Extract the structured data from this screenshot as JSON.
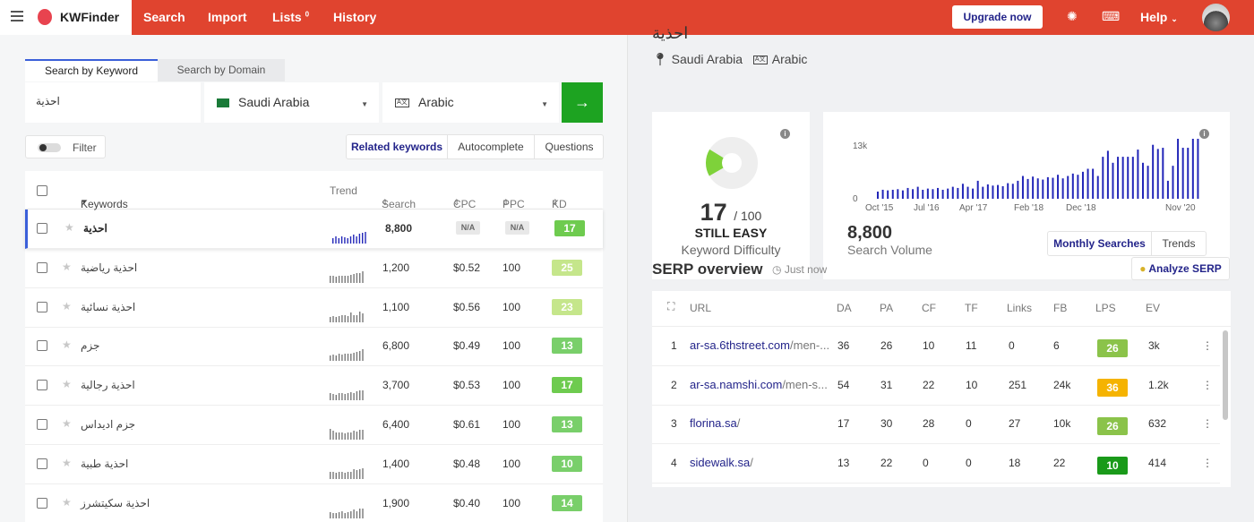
{
  "app": {
    "name": "KWFinder"
  },
  "nav": {
    "search": "Search",
    "import": "Import",
    "lists": "Lists",
    "lists_count": "0",
    "history": "History"
  },
  "topbar": {
    "upgrade": "Upgrade now",
    "help": "Help"
  },
  "search_panel": {
    "tab_keyword": "Search by Keyword",
    "tab_domain": "Search by Domain",
    "keyword": "احذية",
    "country": "Saudi Arabia",
    "language": "Arabic",
    "lang_icon_text": "A文"
  },
  "filter": {
    "label": "Filter"
  },
  "results_tabs": {
    "related": "Related keywords",
    "autocomplete": "Autocomplete",
    "questions": "Questions"
  },
  "kw_table": {
    "columns": {
      "keywords": "Keywords",
      "trend": "Trend",
      "search": "Search",
      "cpc": "CPC",
      "ppc": "PPC",
      "kd": "KD"
    },
    "rows": [
      {
        "keyword": "احذية",
        "search": "8,800",
        "cpc": "N/A",
        "ppc": "N/A",
        "kd": "17",
        "trend": [
          0.45,
          0.55,
          0.4,
          0.6,
          0.5,
          0.45,
          0.55,
          0.7,
          0.6,
          0.75,
          0.85,
          0.95
        ]
      },
      {
        "keyword": "احذية رياضية",
        "search": "1,200",
        "cpc": "$0.52",
        "ppc": "100",
        "kd": "25",
        "trend": [
          0.55,
          0.6,
          0.5,
          0.6,
          0.55,
          0.6,
          0.55,
          0.65,
          0.7,
          0.75,
          0.8,
          0.9
        ]
      },
      {
        "keyword": "احذية نسائية",
        "search": "1,100",
        "cpc": "$0.56",
        "ppc": "100",
        "kd": "23",
        "trend": [
          0.4,
          0.5,
          0.45,
          0.5,
          0.55,
          0.6,
          0.5,
          0.8,
          0.55,
          0.6,
          0.85,
          0.7
        ]
      },
      {
        "keyword": "جزم",
        "search": "6,800",
        "cpc": "$0.49",
        "ppc": "100",
        "kd": "13",
        "trend": [
          0.45,
          0.5,
          0.45,
          0.55,
          0.5,
          0.55,
          0.6,
          0.6,
          0.65,
          0.7,
          0.8,
          0.9
        ]
      },
      {
        "keyword": "احذية رجالية",
        "search": "3,700",
        "cpc": "$0.53",
        "ppc": "100",
        "kd": "17",
        "trend": [
          0.55,
          0.5,
          0.45,
          0.55,
          0.6,
          0.5,
          0.55,
          0.65,
          0.6,
          0.7,
          0.8,
          0.75
        ]
      },
      {
        "keyword": "جزم اديداس",
        "search": "6,400",
        "cpc": "$0.61",
        "ppc": "100",
        "kd": "13",
        "trend": [
          0.85,
          0.7,
          0.6,
          0.55,
          0.6,
          0.5,
          0.55,
          0.6,
          0.7,
          0.65,
          0.75,
          0.8
        ]
      },
      {
        "keyword": "احذية طبية",
        "search": "1,400",
        "cpc": "$0.48",
        "ppc": "100",
        "kd": "10",
        "trend": [
          0.6,
          0.55,
          0.5,
          0.55,
          0.6,
          0.5,
          0.55,
          0.6,
          0.75,
          0.7,
          0.8,
          0.85
        ]
      },
      {
        "keyword": "احذية سكيتشرز",
        "search": "1,900",
        "cpc": "$0.40",
        "ppc": "100",
        "kd": "14",
        "trend": [
          0.5,
          0.45,
          0.4,
          0.5,
          0.55,
          0.45,
          0.5,
          0.6,
          0.7,
          0.6,
          0.75,
          0.8
        ]
      }
    ]
  },
  "detail": {
    "keyword": "احذية",
    "country": "Saudi Arabia",
    "language": "Arabic",
    "difficulty": {
      "value": "17",
      "max": "/ 100",
      "label": "STILL EASY",
      "sublabel": "Keyword Difficulty",
      "fraction": 0.17
    },
    "volume": {
      "value": "8,800",
      "label": "Search Volume",
      "tab_monthly": "Monthly Searches",
      "tab_trends": "Trends",
      "y_ticks": [
        "13k",
        "0"
      ],
      "x_ticks": [
        "Oct '15",
        "Jul '16",
        "Apr '17",
        "Feb '18",
        "Dec '18",
        "Nov '20"
      ],
      "bars": [
        0.12,
        0.15,
        0.14,
        0.15,
        0.16,
        0.14,
        0.18,
        0.16,
        0.2,
        0.15,
        0.17,
        0.16,
        0.18,
        0.15,
        0.17,
        0.2,
        0.18,
        0.25,
        0.2,
        0.17,
        0.3,
        0.2,
        0.24,
        0.22,
        0.23,
        0.21,
        0.26,
        0.25,
        0.3,
        0.38,
        0.33,
        0.37,
        0.34,
        0.32,
        0.36,
        0.35,
        0.4,
        0.34,
        0.38,
        0.42,
        0.4,
        0.45,
        0.5,
        0.5,
        0.38,
        0.7,
        0.8,
        0.6,
        0.7,
        0.7,
        0.7,
        0.7,
        0.82,
        0.6,
        0.55,
        0.9,
        0.83,
        0.85,
        0.3,
        0.55,
        1.0,
        0.85,
        0.85,
        1.0,
        1.0
      ]
    }
  },
  "serp": {
    "title": "SERP overview",
    "time": "Just now",
    "analyze": "Analyze SERP",
    "columns": {
      "url": "URL",
      "da": "DA",
      "pa": "PA",
      "cf": "CF",
      "tf": "TF",
      "links": "Links",
      "fb": "FB",
      "lps": "LPS",
      "ev": "EV"
    },
    "rows": [
      {
        "rank": "1",
        "domain": "ar-sa.6thstreet.com",
        "path": "/men-...",
        "da": "36",
        "pa": "26",
        "cf": "10",
        "tf": "11",
        "links": "0",
        "fb": "6",
        "lps": "26",
        "ev": "3k"
      },
      {
        "rank": "2",
        "domain": "ar-sa.namshi.com",
        "path": "/men-s...",
        "da": "54",
        "pa": "31",
        "cf": "22",
        "tf": "10",
        "links": "251",
        "fb": "24k",
        "lps": "36",
        "ev": "1.2k"
      },
      {
        "rank": "3",
        "domain": "florina.sa",
        "path": "/",
        "da": "17",
        "pa": "30",
        "cf": "28",
        "tf": "0",
        "links": "27",
        "fb": "10k",
        "lps": "26",
        "ev": "632"
      },
      {
        "rank": "4",
        "domain": "sidewalk.sa",
        "path": "/",
        "da": "13",
        "pa": "22",
        "cf": "0",
        "tf": "0",
        "links": "18",
        "fb": "22",
        "lps": "10",
        "ev": "414"
      }
    ]
  },
  "colors": {
    "brand": "#e0442f",
    "accent": "#23248a",
    "go": "#1da321",
    "kd_easy": "#7ed56f",
    "kd_light": "#b9e07c",
    "lps_green": "#8bc34a",
    "lps_amber": "#f7b500",
    "lps_dark": "#1e9e1e",
    "bar": "#2226b8"
  }
}
